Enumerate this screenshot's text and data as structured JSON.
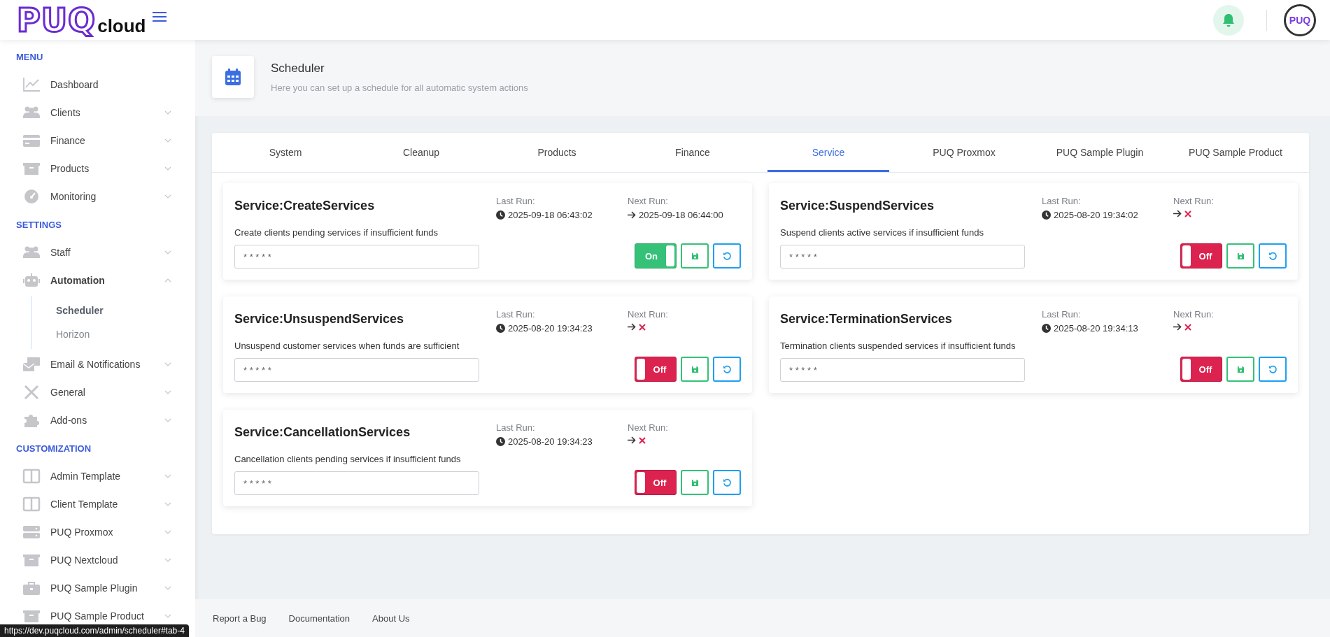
{
  "header": {
    "logo_main": "PUQ",
    "logo_sub": "cloud",
    "avatar": "PUQ"
  },
  "sidebar": {
    "sections": [
      {
        "title": "MENU",
        "items": [
          {
            "label": "Dashboard"
          },
          {
            "label": "Clients",
            "expanded": false
          },
          {
            "label": "Finance",
            "expanded": false
          },
          {
            "label": "Products",
            "expanded": false
          },
          {
            "label": "Monitoring",
            "expanded": false
          }
        ]
      },
      {
        "title": "SETTINGS",
        "items": [
          {
            "label": "Staff",
            "expanded": false
          },
          {
            "label": "Automation",
            "expanded": true,
            "children": [
              {
                "label": "Scheduler",
                "selected": true
              },
              {
                "label": "Horizon",
                "selected": false
              }
            ]
          },
          {
            "label": "Email & Notifications",
            "expanded": false
          },
          {
            "label": "General",
            "expanded": false
          },
          {
            "label": "Add-ons",
            "expanded": false
          }
        ]
      },
      {
        "title": "CUSTOMIZATION",
        "items": [
          {
            "label": "Admin Template",
            "expanded": false
          },
          {
            "label": "Client Template",
            "expanded": false
          },
          {
            "label": "PUQ Proxmox",
            "expanded": false
          },
          {
            "label": "PUQ Nextcloud",
            "expanded": false
          },
          {
            "label": "PUQ Sample Plugin",
            "expanded": false
          },
          {
            "label": "PUQ Sample Product",
            "expanded": false
          }
        ]
      }
    ]
  },
  "page": {
    "title": "Scheduler",
    "subtitle": "Here you can set up a schedule for all automatic system actions"
  },
  "tabs": [
    {
      "label": "System",
      "selected": false
    },
    {
      "label": "Cleanup",
      "selected": false
    },
    {
      "label": "Products",
      "selected": false
    },
    {
      "label": "Finance",
      "selected": false
    },
    {
      "label": "Service",
      "selected": true
    },
    {
      "label": "PUQ Proxmox",
      "selected": false
    },
    {
      "label": "PUQ Sample Plugin",
      "selected": false
    },
    {
      "label": "PUQ Sample Product",
      "selected": false
    }
  ],
  "jobs": [
    {
      "name": "Service:CreateServices",
      "description": "Create clients pending services if insufficient funds",
      "last_run_label": "Last Run:",
      "last_run": "2025-09-18 06:43:02",
      "next_run_label": "Next Run:",
      "next_run": "2025-09-18 06:44:00",
      "cron": "* * * * *",
      "on": true,
      "toggle_label": "On"
    },
    {
      "name": "Service:SuspendServices",
      "description": "Suspend clients active services if insufficient funds",
      "last_run_label": "Last Run:",
      "last_run": "2025-08-20 19:34:02",
      "next_run_label": "Next Run:",
      "cron": "* * * * *",
      "on": false,
      "toggle_label": "Off"
    },
    {
      "name": "Service:UnsuspendServices",
      "description": "Unsuspend customer services when funds are sufficient",
      "last_run_label": "Last Run:",
      "last_run": "2025-08-20 19:34:23",
      "next_run_label": "Next Run:",
      "cron": "* * * * *",
      "on": false,
      "toggle_label": "Off"
    },
    {
      "name": "Service:TerminationServices",
      "description": "Termination clients suspended services if insufficient funds",
      "last_run_label": "Last Run:",
      "last_run": "2025-08-20 19:34:13",
      "next_run_label": "Next Run:",
      "cron": "* * * * *",
      "on": false,
      "toggle_label": "Off"
    },
    {
      "name": "Service:CancellationServices",
      "description": "Cancellation clients pending services if insufficient funds",
      "last_run_label": "Last Run:",
      "last_run": "2025-08-20 19:34:23",
      "next_run_label": "Next Run:",
      "cron": "* * * * *",
      "on": false,
      "toggle_label": "Off"
    }
  ],
  "footer": {
    "links": [
      "Report a Bug",
      "Documentation",
      "About Us"
    ]
  },
  "status_bar": {
    "url": "https://dev.puqcloud.com/admin/scheduler#tab-4"
  }
}
